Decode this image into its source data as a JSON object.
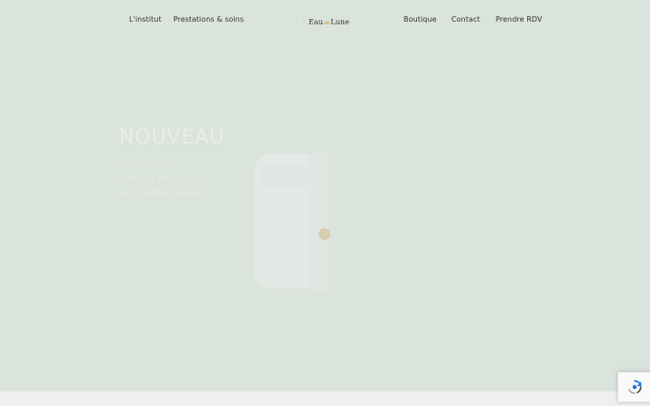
{
  "nav": {
    "left": [
      "L'institut",
      "Prestations & soins"
    ],
    "right": [
      "Boutique",
      "Contact",
      "Prendre RDV"
    ],
    "logo": {
      "prefix": "Eau",
      "middle": "de",
      "suffix": "Lune"
    }
  },
  "hero": {
    "title": "NOUVEAU",
    "subtitle": "Les soins du\ncontour des yeux\net le jardin Brunge"
  },
  "colors": {
    "background": "#dbe3dd",
    "accent": "#c9ae70"
  },
  "icons": {
    "captcha": "recaptcha-icon",
    "logo": "moon-icon"
  }
}
